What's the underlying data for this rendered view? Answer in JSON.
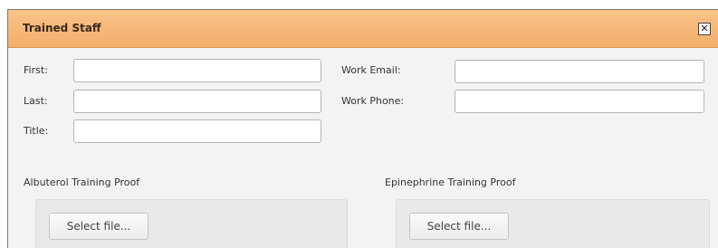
{
  "dialog": {
    "title": "Trained Staff",
    "close_glyph": "✕",
    "close_icon": "close-icon"
  },
  "form": {
    "first_label": "First:",
    "first_value": "",
    "last_label": "Last:",
    "last_value": "",
    "title_label": "Title:",
    "title_value": "",
    "work_email_label": "Work Email:",
    "work_email_value": "",
    "work_phone_label": "Work Phone:",
    "work_phone_value": ""
  },
  "uploads": {
    "albuterol": {
      "heading": "Albuterol Training Proof",
      "button_label": "Select file..."
    },
    "epinephrine": {
      "heading": "Epinephrine Training Proof",
      "button_label": "Select file..."
    }
  },
  "colors": {
    "header_accent": "#f3ad68",
    "dialog_background": "#f3f3f3"
  }
}
